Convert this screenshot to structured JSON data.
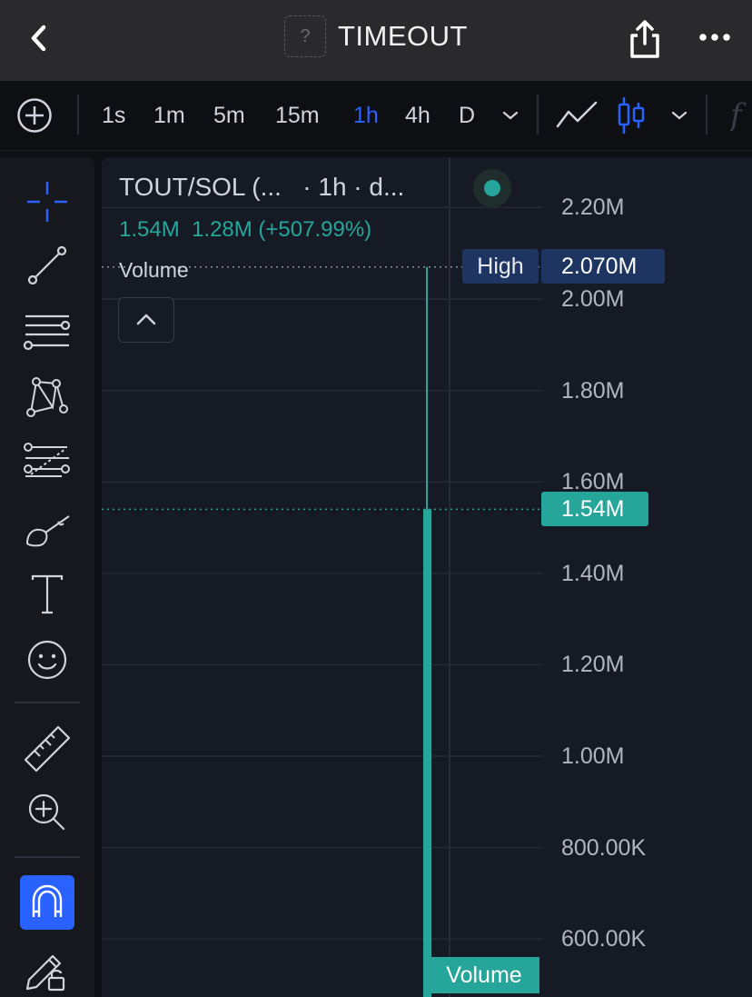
{
  "header": {
    "title": "TIMEOUT",
    "token_icon_glyph": "?",
    "icons": {
      "back": "chevron-left-icon",
      "share": "share-icon",
      "more": "more-horizontal-icon"
    }
  },
  "toolbar": {
    "timeframes": [
      {
        "label": "1s",
        "active": false
      },
      {
        "label": "1m",
        "active": false
      },
      {
        "label": "5m",
        "active": false
      },
      {
        "label": "15m",
        "active": false
      },
      {
        "label": "1h",
        "active": true
      },
      {
        "label": "4h",
        "active": false
      },
      {
        "label": "D",
        "active": false
      }
    ],
    "active_color": "#2962ff",
    "chart_type_selected": "candles",
    "fx_glyph": "f"
  },
  "drawing_tools": [
    "crosshair-icon",
    "trend-line-icon",
    "horizontal-lines-icon",
    "pattern-icon",
    "fib-retracement-icon",
    "brush-icon",
    "text-icon",
    "emoji-icon",
    "ruler-icon",
    "zoom-in-icon",
    "magnet-icon",
    "lock-drawings-icon"
  ],
  "chart": {
    "legend": {
      "symbol": "TOUT/SOL (...",
      "meta": "· 1h · d...",
      "last_value": "1.54M",
      "change": "1.28M (+507.99%)"
    },
    "volume_label": "Volume",
    "high_label": "High",
    "high_value": "2.070M",
    "last_price_label": "1.54M",
    "volume_tag": "Volume",
    "up_color": "#26a69a",
    "high_tag_color": "#1e3461"
  },
  "chart_data": {
    "type": "bar",
    "series": [
      {
        "name": "Volume",
        "values": [
          1540000
        ],
        "high": 2070000
      }
    ],
    "ylim": [
      500000,
      2300000
    ],
    "y_ticks": [
      "2.20M",
      "2.00M",
      "1.80M",
      "1.60M",
      "1.40M",
      "1.20M",
      "1.00M",
      "800.00K",
      "600.00K"
    ],
    "y_tick_values": [
      2200000,
      2000000,
      1800000,
      1600000,
      1400000,
      1200000,
      1000000,
      800000,
      600000
    ],
    "grid": true,
    "last_value": 1540000,
    "high_value": 2070000
  }
}
